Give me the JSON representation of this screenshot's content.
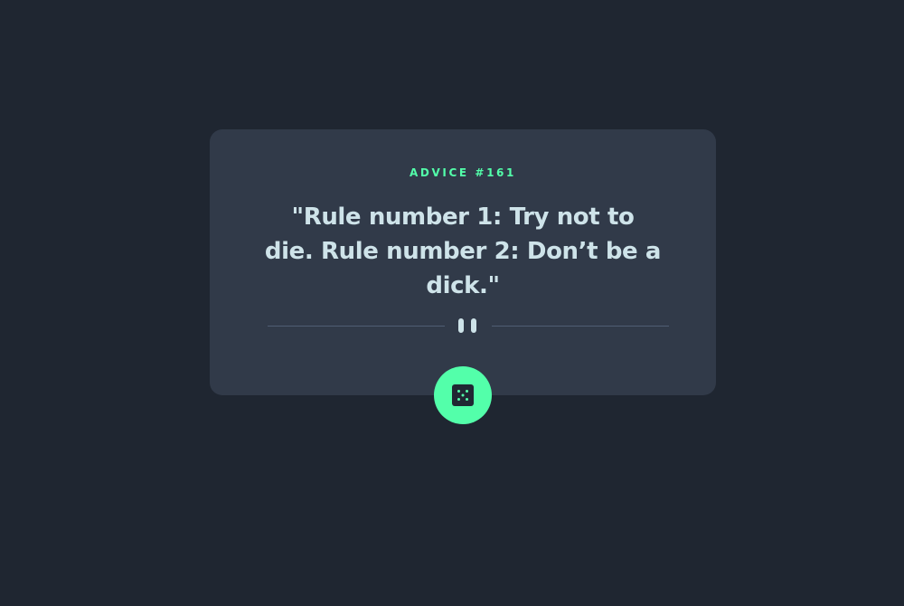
{
  "advice": {
    "label": "ADVICE #161",
    "quote": "\"Rule number 1: Try not to die. Rule number 2: Don’t be a dick.\""
  },
  "icons": {
    "divider": "pause-icon",
    "button": "dice-icon"
  },
  "colors": {
    "background": "#1f2631",
    "card": "#313a49",
    "accent": "#53ffaa",
    "text": "#cee3e9",
    "divider_line": "#4f5d74"
  }
}
